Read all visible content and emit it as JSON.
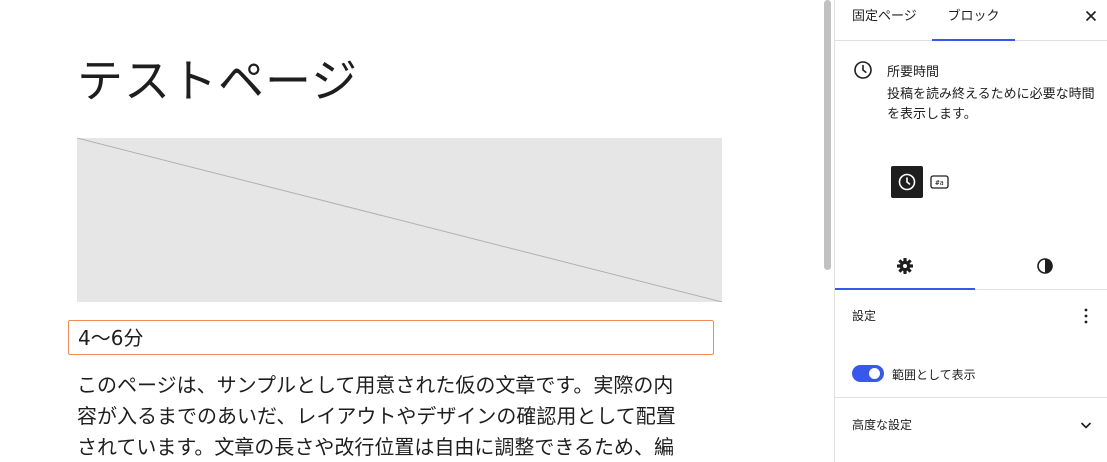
{
  "editor": {
    "title": "テストページ",
    "reading_time": "4〜6分",
    "paragraph_lines": [
      "このページは、サンプルとして用意された仮の文章です。実際の内",
      "容が入るまでのあいだ、レイアウトやデザインの確認用として配置",
      "されています。文章の長さや改行位置は自由に調整できるため、編"
    ]
  },
  "sidebar": {
    "tabs": [
      {
        "label": "固定ページ",
        "active": false
      },
      {
        "label": "ブロック",
        "active": true
      }
    ],
    "close_icon": "close-icon",
    "block_card": {
      "icon": "clock-icon",
      "title": "所要時間",
      "description_lines": [
        "投稿を読み終えるために必要な時間",
        "を表示します。"
      ]
    },
    "variations": [
      {
        "icon": "clock-icon",
        "active": true
      },
      {
        "icon": "word-count-icon",
        "active": false
      }
    ],
    "inspector_tabs": [
      {
        "icon": "gear-icon",
        "active": true
      },
      {
        "icon": "contrast-icon",
        "active": false
      }
    ],
    "settings_panel": {
      "title": "設定",
      "toggle_label": "範囲として表示",
      "toggle_on": true
    },
    "advanced_panel": {
      "title": "高度な設定",
      "expanded": false
    }
  },
  "colors": {
    "accent": "#3858e9",
    "selection_border": "#f08c5a",
    "placeholder_bg": "#e6e6e6",
    "text": "#1e1e1e"
  }
}
